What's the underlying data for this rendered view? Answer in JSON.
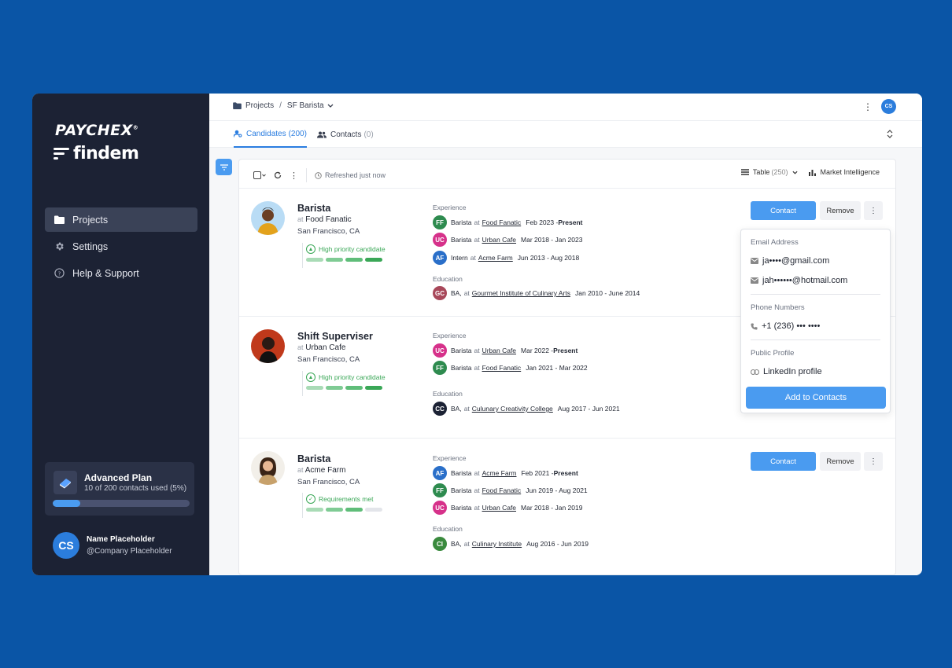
{
  "sidebar": {
    "brand_top": "PAYCHEX",
    "brand_bottom": "findem",
    "nav": [
      {
        "label": "Projects",
        "icon": "folder-icon",
        "active": true
      },
      {
        "label": "Settings",
        "icon": "gear-icon",
        "active": false
      },
      {
        "label": "Help & Support",
        "icon": "help-icon",
        "active": false
      }
    ],
    "plan": {
      "title": "Advanced Plan",
      "usage": "10 of 200 contacts used (5%)",
      "progress": 0.05
    },
    "user": {
      "initials": "CS",
      "name": "Name Placeholder",
      "company": "@Company Placeholder"
    }
  },
  "header": {
    "breadcrumb_root": "Projects",
    "breadcrumb_sep": "/",
    "breadcrumb_current": "SF Barista",
    "avatar_initials": "CS"
  },
  "tabs": [
    {
      "label": "Candidates",
      "count": "(200)",
      "active": true
    },
    {
      "label": "Contacts",
      "count": "(0)",
      "active": false
    }
  ],
  "toolbar": {
    "refresh_text": "Refreshed just now",
    "view_label": "Table",
    "view_count": "(250)",
    "intel_label": "Market Intelligence"
  },
  "labels": {
    "experience": "Experience",
    "education": "Education",
    "at": "at",
    "contact": "Contact",
    "remove": "Remove"
  },
  "candidates": [
    {
      "title": "Barista",
      "company": "Food Fanatic",
      "location": "San Francisco, CA",
      "priority": "High priority candidate",
      "priority_level": 4,
      "experience": [
        {
          "logo": "FF",
          "color": "#2e8b4f",
          "role": "Barista",
          "company": "Food Fanatic",
          "dates": "Feb 2023 - ",
          "present": "Present"
        },
        {
          "logo": "UC",
          "color": "#d6318a",
          "role": "Barista",
          "company": "Urban Cafe",
          "dates": "Mar 2018 - Jan 2023",
          "present": ""
        },
        {
          "logo": "AF",
          "color": "#2a6fc9",
          "role": "Intern",
          "company": "Acme Farm",
          "dates": "Jun 2013 - Aug 2018",
          "present": ""
        }
      ],
      "education": [
        {
          "logo": "GC",
          "color": "#a8485a",
          "degree": "BA,",
          "school": "Gourmet Institute of Culinary Arts",
          "dates": "Jan 2010 - June 2014"
        }
      ]
    },
    {
      "title": "Shift Superviser",
      "company": "Urban Cafe",
      "location": "San Francisco, CA",
      "priority": "High priority candidate",
      "priority_level": 4,
      "experience": [
        {
          "logo": "UC",
          "color": "#d6318a",
          "role": "Barista",
          "company": "Urban Cafe",
          "dates": "Mar 2022 - ",
          "present": "Present"
        },
        {
          "logo": "FF",
          "color": "#2e8b4f",
          "role": "Barista",
          "company": "Food Fanatic",
          "dates": "Jan 2021 - Mar 2022",
          "present": ""
        }
      ],
      "education": [
        {
          "logo": "CC",
          "color": "#1c2234",
          "degree": "BA,",
          "school": "Culunary Creativity College",
          "dates": "Aug 2017 - Jun 2021"
        }
      ]
    },
    {
      "title": "Barista",
      "company": "Acme Farm",
      "location": "San Francisco, CA",
      "priority": "Requirements met",
      "priority_level": 3,
      "experience": [
        {
          "logo": "AF",
          "color": "#2a6fc9",
          "role": "Barista",
          "company": "Acme Farm",
          "dates": "Feb 2021 - ",
          "present": "Present"
        },
        {
          "logo": "FF",
          "color": "#2e8b4f",
          "role": "Barista",
          "company": "Food Fanatic",
          "dates": "Jun 2019 - Aug 2021",
          "present": ""
        },
        {
          "logo": "UC",
          "color": "#d6318a",
          "role": "Barista",
          "company": "Urban Cafe",
          "dates": "Mar 2018 - Jan 2019",
          "present": ""
        }
      ],
      "education": [
        {
          "logo": "CI",
          "color": "#3a8a3e",
          "degree": "BA,",
          "school": "Culinary Institute",
          "dates": "Aug 2016 - Jun 2019"
        }
      ]
    }
  ],
  "popover": {
    "email_header": "Email Address",
    "emails": [
      "ja••••@gmail.com",
      "jah••••••@hotmail.com"
    ],
    "phone_header": "Phone Numbers",
    "phone": "+1 (236) ••• ••••",
    "profile_header": "Public Profile",
    "profile_link": "LinkedIn profile",
    "add_button": "Add to Contacts"
  },
  "colors": {
    "accent": "#4a9bf0",
    "sidebar": "#1c2234",
    "background": "#0a55a6",
    "priority_green": "#3aa757"
  }
}
